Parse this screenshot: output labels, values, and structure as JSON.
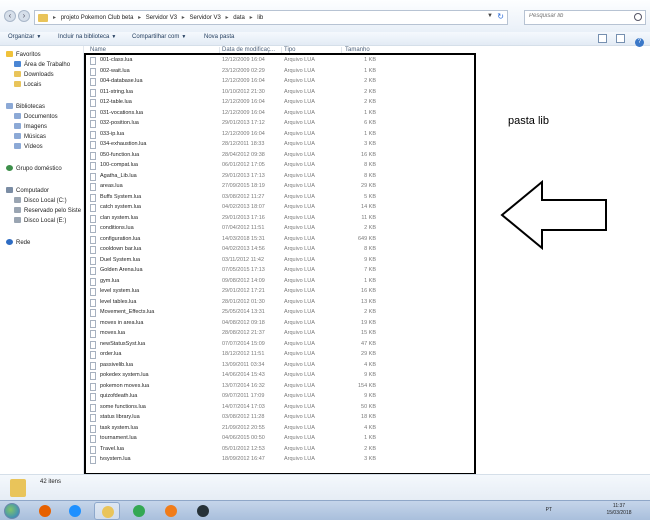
{
  "address": {
    "breadcrumbs": [
      "projeto Pokemon Club beta",
      "Servidor V3",
      "Servidor V3",
      "data",
      "lib"
    ],
    "separator": "▸",
    "search_placeholder": "Pesquisar lib"
  },
  "toolbar": {
    "organize": "Organizar",
    "include_library": "Incluir na biblioteca",
    "share": "Compartilhar com",
    "new_folder": "Nova pasta",
    "dropdown_arrow": "▼"
  },
  "nav": {
    "favorites": "Favoritos",
    "desktop": "Área de Trabalho",
    "downloads": "Downloads",
    "recent": "Locais",
    "libraries": "Bibliotecas",
    "documents": "Documentos",
    "images": "Imagens",
    "music": "Músicas",
    "videos": "Vídeos",
    "homegroup": "Grupo doméstico",
    "computer": "Computador",
    "disk_c": "Disco Local (C:)",
    "disk_reserved": "Reservado pelo Siste",
    "disk_e": "Disco Local (E:)",
    "network": "Rede"
  },
  "columns": {
    "name": "Name",
    "date": "Data de modificaç...",
    "type": "Tipo",
    "size": "Tamanho"
  },
  "files": [
    {
      "name": "001-class.lua",
      "date": "12/12/2009 16:04",
      "type": "Arquivo LUA",
      "size": "1 KB"
    },
    {
      "name": "002-wait.lua",
      "date": "23/12/2009 02:29",
      "type": "Arquivo LUA",
      "size": "1 KB"
    },
    {
      "name": "004-database.lua",
      "date": "12/12/2009 16:04",
      "type": "Arquivo LUA",
      "size": "2 KB"
    },
    {
      "name": "011-string.lua",
      "date": "10/10/2012 21:30",
      "type": "Arquivo LUA",
      "size": "2 KB"
    },
    {
      "name": "012-table.lua",
      "date": "12/12/2009 16:04",
      "type": "Arquivo LUA",
      "size": "2 KB"
    },
    {
      "name": "031-vocations.lua",
      "date": "12/12/2009 16:04",
      "type": "Arquivo LUA",
      "size": "1 KB"
    },
    {
      "name": "032-position.lua",
      "date": "29/01/2013 17:12",
      "type": "Arquivo LUA",
      "size": "6 KB"
    },
    {
      "name": "033-ip.lua",
      "date": "12/12/2009 16:04",
      "type": "Arquivo LUA",
      "size": "1 KB"
    },
    {
      "name": "034-exhaustion.lua",
      "date": "28/12/2011 18:33",
      "type": "Arquivo LUA",
      "size": "3 KB"
    },
    {
      "name": "050-function.lua",
      "date": "28/04/2012 09:38",
      "type": "Arquivo LUA",
      "size": "16 KB"
    },
    {
      "name": "100-compat.lua",
      "date": "06/01/2012 17:05",
      "type": "Arquivo LUA",
      "size": "8 KB"
    },
    {
      "name": "Agatha_Lib.lua",
      "date": "29/01/2013 17:13",
      "type": "Arquivo LUA",
      "size": "8 KB"
    },
    {
      "name": "areas.lua",
      "date": "27/09/2015 18:19",
      "type": "Arquivo LUA",
      "size": "29 KB"
    },
    {
      "name": "Buffs System.lua",
      "date": "03/08/2012 11:27",
      "type": "Arquivo LUA",
      "size": "5 KB"
    },
    {
      "name": "catch system.lua",
      "date": "04/02/2013 18:07",
      "type": "Arquivo LUA",
      "size": "14 KB"
    },
    {
      "name": "clan system.lua",
      "date": "29/01/2013 17:16",
      "type": "Arquivo LUA",
      "size": "11 KB"
    },
    {
      "name": "conditions.lua",
      "date": "07/04/2012 11:51",
      "type": "Arquivo LUA",
      "size": "2 KB"
    },
    {
      "name": "configuration.lua",
      "date": "14/03/2018 15:31",
      "type": "Arquivo LUA",
      "size": "649 KB"
    },
    {
      "name": "cooldown bar.lua",
      "date": "04/02/2013 14:56",
      "type": "Arquivo LUA",
      "size": "8 KB"
    },
    {
      "name": "Duel System.lua",
      "date": "03/11/2012 11:42",
      "type": "Arquivo LUA",
      "size": "9 KB"
    },
    {
      "name": "Golden Arena.lua",
      "date": "07/05/2015 17:13",
      "type": "Arquivo LUA",
      "size": "7 KB"
    },
    {
      "name": "gym.lua",
      "date": "09/08/2012 14:09",
      "type": "Arquivo LUA",
      "size": "1 KB"
    },
    {
      "name": "level system.lua",
      "date": "29/01/2012 17:21",
      "type": "Arquivo LUA",
      "size": "16 KB"
    },
    {
      "name": "level tables.lua",
      "date": "28/01/2012 01:30",
      "type": "Arquivo LUA",
      "size": "13 KB"
    },
    {
      "name": "Movement_Effects.lua",
      "date": "25/05/2014 13:31",
      "type": "Arquivo LUA",
      "size": "2 KB"
    },
    {
      "name": "moves in area.lua",
      "date": "04/08/2012 09:18",
      "type": "Arquivo LUA",
      "size": "19 KB"
    },
    {
      "name": "moves.lua",
      "date": "28/08/2012 21:37",
      "type": "Arquivo LUA",
      "size": "15 KB"
    },
    {
      "name": "newStatusSyst.lua",
      "date": "07/07/2014 15:09",
      "type": "Arquivo LUA",
      "size": "47 KB"
    },
    {
      "name": "order.lua",
      "date": "18/12/2012 11:51",
      "type": "Arquivo LUA",
      "size": "29 KB"
    },
    {
      "name": "passivelib.lua",
      "date": "13/09/2011 03:34",
      "type": "Arquivo LUA",
      "size": "4 KB"
    },
    {
      "name": "pokedex system.lua",
      "date": "14/06/2014 15:43",
      "type": "Arquivo LUA",
      "size": "9 KB"
    },
    {
      "name": "pokemon moves.lua",
      "date": "13/07/2014 16:32",
      "type": "Arquivo LUA",
      "size": "154 KB"
    },
    {
      "name": "quizofdeath.lua",
      "date": "09/07/2011 17:09",
      "type": "Arquivo LUA",
      "size": "9 KB"
    },
    {
      "name": "some functions.lua",
      "date": "14/07/2014 17:03",
      "type": "Arquivo LUA",
      "size": "50 KB"
    },
    {
      "name": "status library.lua",
      "date": "03/08/2012 11:28",
      "type": "Arquivo LUA",
      "size": "18 KB"
    },
    {
      "name": "task system.lua",
      "date": "21/09/2012 20:55",
      "type": "Arquivo LUA",
      "size": "4 KB"
    },
    {
      "name": "tournament.lua",
      "date": "04/06/2015 00:50",
      "type": "Arquivo LUA",
      "size": "1 KB"
    },
    {
      "name": "Travel.lua",
      "date": "05/01/2012 12:53",
      "type": "Arquivo LUA",
      "size": "2 KB"
    },
    {
      "name": "tvsystem.lua",
      "date": "18/09/2012 16:47",
      "type": "Arquivo LUA",
      "size": "3 KB"
    }
  ],
  "annotation": {
    "label": "pasta lib"
  },
  "details": {
    "count": "42 itens"
  },
  "taskbar": {
    "lang": "PT",
    "time": "11:37",
    "date": "15/03/2018",
    "colors": {
      "firefox": "#e66000",
      "ie": "#1e90ff",
      "explorer": "#e9c45a",
      "chrome": "#34a853",
      "media": "#f07c1a",
      "app": "#263238"
    }
  }
}
